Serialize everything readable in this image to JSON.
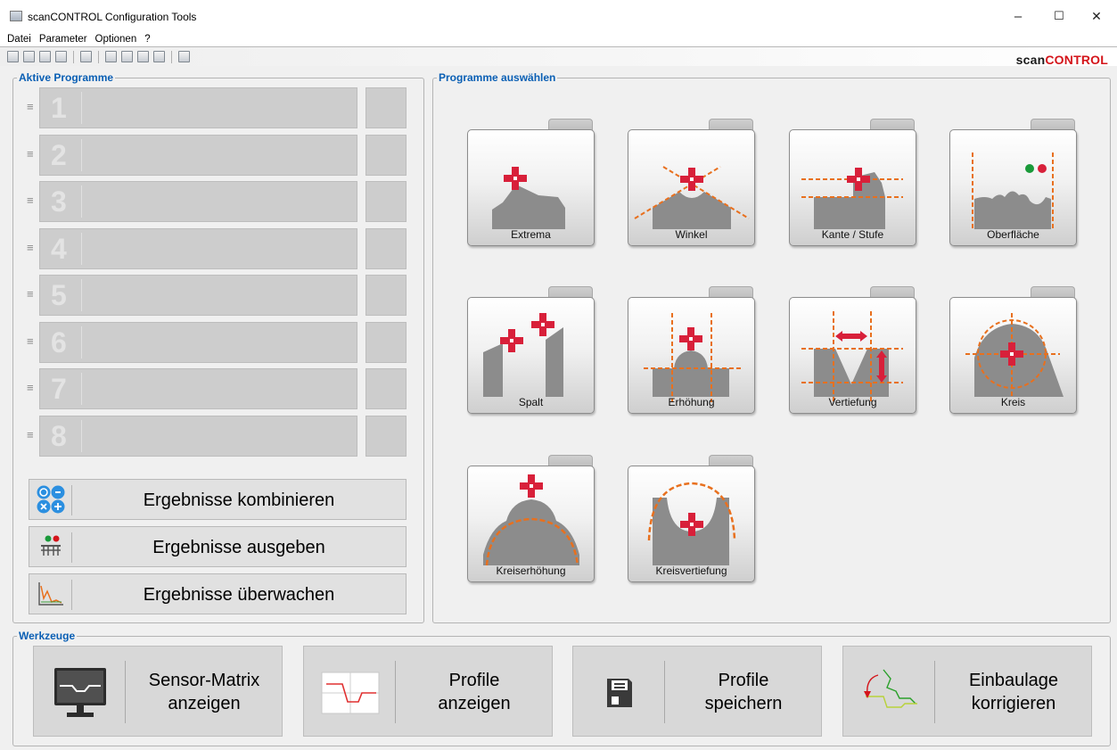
{
  "window": {
    "title": "scanCONTROL Configuration Tools",
    "controls": {
      "minimize": "–",
      "maximize": "☐",
      "close": "✕"
    }
  },
  "menu": [
    "Datei",
    "Parameter",
    "Optionen",
    "?"
  ],
  "brand": {
    "part1": "scan",
    "part2": "CONTROL",
    "colors": {
      "dark": "#1a1a1a",
      "red": "#d4141a"
    }
  },
  "active_programs": {
    "label": "Aktive Programme",
    "slots": [
      "1",
      "2",
      "3",
      "4",
      "5",
      "6",
      "7",
      "8"
    ],
    "handle": "≡",
    "actions": [
      {
        "label": "Ergebnisse kombinieren",
        "icon": "combine-icon"
      },
      {
        "label": "Ergebnisse ausgeben",
        "icon": "output-icon"
      },
      {
        "label": "Ergebnisse überwachen",
        "icon": "monitor-chart-icon"
      }
    ]
  },
  "programs": {
    "label": "Programme auswählen",
    "items": [
      {
        "label": "Extrema",
        "icon": "extrema-icon"
      },
      {
        "label": "Winkel",
        "icon": "angle-icon"
      },
      {
        "label": "Kante / Stufe",
        "icon": "edge-step-icon"
      },
      {
        "label": "Oberfläche",
        "icon": "surface-icon"
      },
      {
        "label": "Spalt",
        "icon": "gap-icon"
      },
      {
        "label": "Erhöhung",
        "icon": "elevation-icon"
      },
      {
        "label": "Vertiefung",
        "icon": "depression-icon"
      },
      {
        "label": "Kreis",
        "icon": "circle-icon"
      },
      {
        "label": "Kreiserhöhung",
        "icon": "circle-elevation-icon"
      },
      {
        "label": "Kreisvertiefung",
        "icon": "circle-depression-icon"
      }
    ]
  },
  "tools": {
    "label": "Werkzeuge",
    "items": [
      {
        "label": "Sensor-Matrix\nanzeigen",
        "icon": "monitor-icon"
      },
      {
        "label": "Profile\nanzeigen",
        "icon": "profile-chart-icon"
      },
      {
        "label": "Profile\nspeichern",
        "icon": "floppy-disk-icon"
      },
      {
        "label": "Einbaulage\nkorrigieren",
        "icon": "rotate-correction-icon"
      }
    ]
  },
  "accent": {
    "red": "#d8203a",
    "orange": "#e8701e",
    "gray": "#8c8c8c",
    "group_label": "#0a5fb4"
  }
}
